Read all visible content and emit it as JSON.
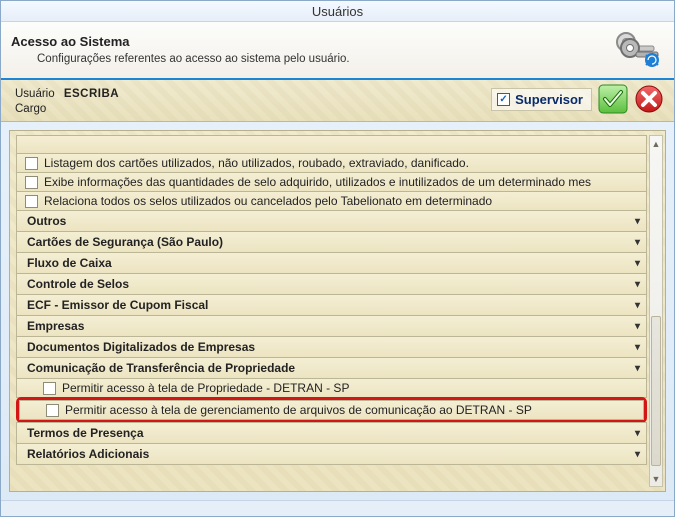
{
  "window": {
    "title": "Usuários"
  },
  "header": {
    "title": "Acesso ao Sistema",
    "subtitle": "Configurações referentes ao acesso ao sistema pelo usuário."
  },
  "userbar": {
    "label_user": "Usuário",
    "value_user": "ESCRIBA",
    "label_role": "Cargo",
    "value_role": "",
    "supervisor_label": "Supervisor",
    "supervisor_checked": true
  },
  "permissions_top": [
    "Listagem dos cartões utilizados, não utilizados, roubado, extraviado, danificado.",
    "Exibe informações das quantidades de selo adquirido, utilizados e inutilizados de um determinado mes",
    "Relaciona todos os selos utilizados ou cancelados pelo Tabelionato em determinado"
  ],
  "sections_a": [
    "Outros",
    "Cartões de Segurança (São Paulo)",
    "Fluxo de Caixa",
    "Controle de Selos",
    "ECF - Emissor de Cupom Fiscal",
    "Empresas",
    "Documentos Digitalizados de Empresas"
  ],
  "section_comm": {
    "title": "Comunicação de Transferência de Propriedade",
    "perm1": "Permitir acesso à tela de Propriedade - DETRAN - SP",
    "perm2": "Permitir acesso à tela de gerenciamento de arquivos de comunicação ao DETRAN - SP"
  },
  "sections_b": [
    "Termos de Presença",
    "Relatórios Adicionais"
  ],
  "icons": {
    "check_glyph": "✓",
    "chevron_glyph": "▾",
    "scroll_up": "▲",
    "scroll_down": "▼"
  }
}
